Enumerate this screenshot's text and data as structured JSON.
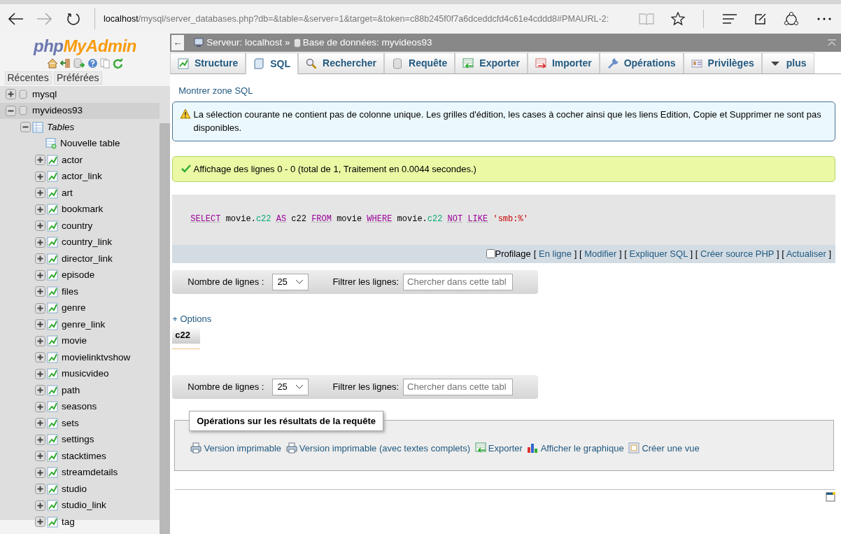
{
  "browser": {
    "url_host": "localhost",
    "url_rest": "/mysql/server_databases.php?db=&table=&server=1&target=&token=c88b245f0f7a6dceddcfd4c61e4cddd8#PMAURL-2:"
  },
  "sidebar": {
    "logo_php": "php",
    "logo_myadmin": "MyAdmin",
    "tabs": [
      "Récentes",
      "Préférées"
    ],
    "tree": [
      {
        "label": "mysql",
        "kind": "database",
        "expanded": false
      },
      {
        "label": "myvideos93",
        "kind": "database",
        "expanded": true,
        "children": [
          {
            "label": "Tables",
            "kind": "group",
            "expanded": true,
            "children": [
              {
                "label": "Nouvelle table",
                "kind": "new"
              },
              {
                "label": "actor",
                "kind": "table",
                "expanded": false
              },
              {
                "label": "actor_link",
                "kind": "table",
                "expanded": false
              },
              {
                "label": "art",
                "kind": "table",
                "expanded": false
              },
              {
                "label": "bookmark",
                "kind": "table",
                "expanded": false
              },
              {
                "label": "country",
                "kind": "table",
                "expanded": false
              },
              {
                "label": "country_link",
                "kind": "table",
                "expanded": false
              },
              {
                "label": "director_link",
                "kind": "table",
                "expanded": false
              },
              {
                "label": "episode",
                "kind": "table",
                "expanded": false
              },
              {
                "label": "files",
                "kind": "table",
                "expanded": false
              },
              {
                "label": "genre",
                "kind": "table",
                "expanded": false
              },
              {
                "label": "genre_link",
                "kind": "table",
                "expanded": false
              },
              {
                "label": "movie",
                "kind": "table",
                "expanded": false
              },
              {
                "label": "movielinktvshow",
                "kind": "table",
                "expanded": false
              },
              {
                "label": "musicvideo",
                "kind": "table",
                "expanded": false
              },
              {
                "label": "path",
                "kind": "table",
                "expanded": false
              },
              {
                "label": "seasons",
                "kind": "table",
                "expanded": false
              },
              {
                "label": "sets",
                "kind": "table",
                "expanded": false
              },
              {
                "label": "settings",
                "kind": "table",
                "expanded": false
              },
              {
                "label": "stacktimes",
                "kind": "table",
                "expanded": false
              },
              {
                "label": "streamdetails",
                "kind": "table",
                "expanded": false
              },
              {
                "label": "studio",
                "kind": "table",
                "expanded": false
              },
              {
                "label": "studio_link",
                "kind": "table",
                "expanded": false
              },
              {
                "label": "tag",
                "kind": "table",
                "expanded": false
              }
            ]
          }
        ]
      }
    ]
  },
  "breadcrumb": {
    "back": "←",
    "server": "Serveur: localhost »",
    "database": "Base de données: myvideos93"
  },
  "tabs": [
    {
      "label": "Structure",
      "kind": "structure",
      "selected": false
    },
    {
      "label": "SQL",
      "kind": "sql",
      "selected": true
    },
    {
      "label": "Rechercher",
      "kind": "search",
      "selected": false
    },
    {
      "label": "Requête",
      "kind": "query",
      "selected": false
    },
    {
      "label": "Exporter",
      "kind": "export",
      "selected": false
    },
    {
      "label": "Importer",
      "kind": "import",
      "selected": false
    },
    {
      "label": "Opérations",
      "kind": "operations",
      "selected": false
    },
    {
      "label": "Privilèges",
      "kind": "privileges",
      "selected": false
    },
    {
      "label": "plus",
      "kind": "more",
      "selected": false
    }
  ],
  "show_sql": "Montrer zone SQL",
  "warning": "La sélection courante ne contient pas de colonne unique. Les grilles d'édition, les cases à cocher ainsi que les liens Edition, Copie et Supprimer ne sont pas disponibles.",
  "success": "Affichage des lignes 0 - 0 (total de 1, Traitement en 0.0044 secondes.)",
  "sql_query": [
    {
      "parts": [
        {
          "text": "SELECT",
          "kind": "keyword"
        }
      ]
    },
    {
      "parts": [
        {
          "text": "movie.",
          "kind": "plain"
        },
        {
          "text": "c22",
          "kind": "field"
        }
      ]
    },
    {
      "parts": [
        {
          "text": "AS",
          "kind": "keyword"
        }
      ]
    },
    {
      "parts": [
        {
          "text": "c22",
          "kind": "plain"
        }
      ]
    },
    {
      "parts": [
        {
          "text": "FROM",
          "kind": "keyword"
        }
      ]
    },
    {
      "parts": [
        {
          "text": "movie",
          "kind": "plain"
        }
      ]
    },
    {
      "parts": [
        {
          "text": "WHERE",
          "kind": "keyword"
        }
      ]
    },
    {
      "parts": [
        {
          "text": "movie.",
          "kind": "plain"
        },
        {
          "text": "c22",
          "kind": "field"
        }
      ]
    },
    {
      "parts": [
        {
          "text": "NOT",
          "kind": "keyword"
        }
      ]
    },
    {
      "parts": [
        {
          "text": "LIKE",
          "kind": "keyword"
        }
      ]
    },
    {
      "parts": [
        {
          "text": "'smb:%'",
          "kind": "string"
        }
      ]
    }
  ],
  "query_tools": {
    "profiling": {
      "label": "Profilage",
      "checked": false
    },
    "open": "[",
    "close": "]",
    "links": [
      "En ligne",
      "Modifier",
      "Expliquer SQL",
      "Créer source PHP",
      "Actualiser"
    ]
  },
  "navigation": [
    {
      "rows_label": "Nombre de lignes :",
      "rows_value": "25",
      "filter_label": "Filtrer les lignes:",
      "filter_placeholder": "Chercher dans cette tabl"
    },
    {
      "rows_label": "Nombre de lignes :",
      "rows_value": "25",
      "filter_label": "Filtrer les lignes:",
      "filter_placeholder": "Chercher dans cette tabl"
    }
  ],
  "options_link": "+ Options",
  "result_table": {
    "columns": [
      "c22"
    ]
  },
  "operations": {
    "legend": "Opérations sur les résultats de la requête",
    "links": [
      {
        "label": "Version imprimable",
        "kind": "print"
      },
      {
        "label": "Version imprimable (avec textes complets)",
        "kind": "print"
      },
      {
        "label": "Exporter",
        "kind": "export"
      },
      {
        "label": "Afficher le graphique",
        "kind": "chart"
      },
      {
        "label": "Créer une vue",
        "kind": "view"
      }
    ]
  }
}
